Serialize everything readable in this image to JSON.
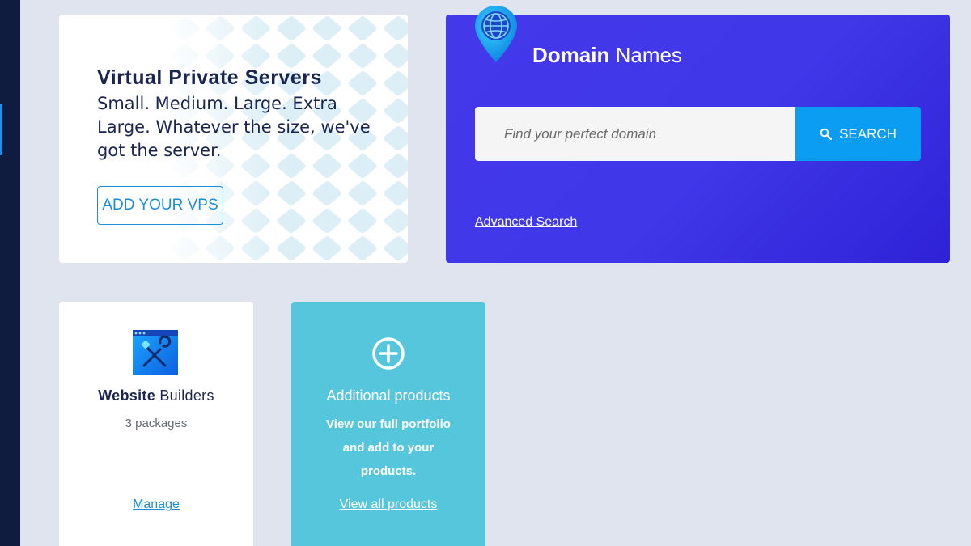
{
  "vps_card": {
    "title": "Virtual Private Servers",
    "description": "Small. Medium. Large. Extra Large. Whatever the size, we've got the server.",
    "button_label": "ADD YOUR VPS"
  },
  "domain_card": {
    "title_bold": "Domain",
    "title_regular": "Names",
    "search_placeholder": "Find your perfect domain",
    "search_button_label": "SEARCH",
    "advanced_search_label": "Advanced Search"
  },
  "website_builders_card": {
    "title_bold": "Website",
    "title_regular": "Builders",
    "packages": "3 packages",
    "manage_label": "Manage"
  },
  "additional_products_card": {
    "title": "Additional products",
    "description": "View our full portfolio and add to your products.",
    "link_label": "View all products"
  },
  "icons": {
    "domain": "globe-pin-icon",
    "search": "search-icon",
    "website_builders": "tools-window-icon",
    "additional_products": "plus-circle-icon"
  },
  "colors": {
    "background": "#dfe4ee",
    "sidebar": "#0f1c3f",
    "accent_blue": "#1b8ed6",
    "domain_card": "#4439ea",
    "search_button": "#0a9df2",
    "additional_products_card": "#56c6dd"
  }
}
